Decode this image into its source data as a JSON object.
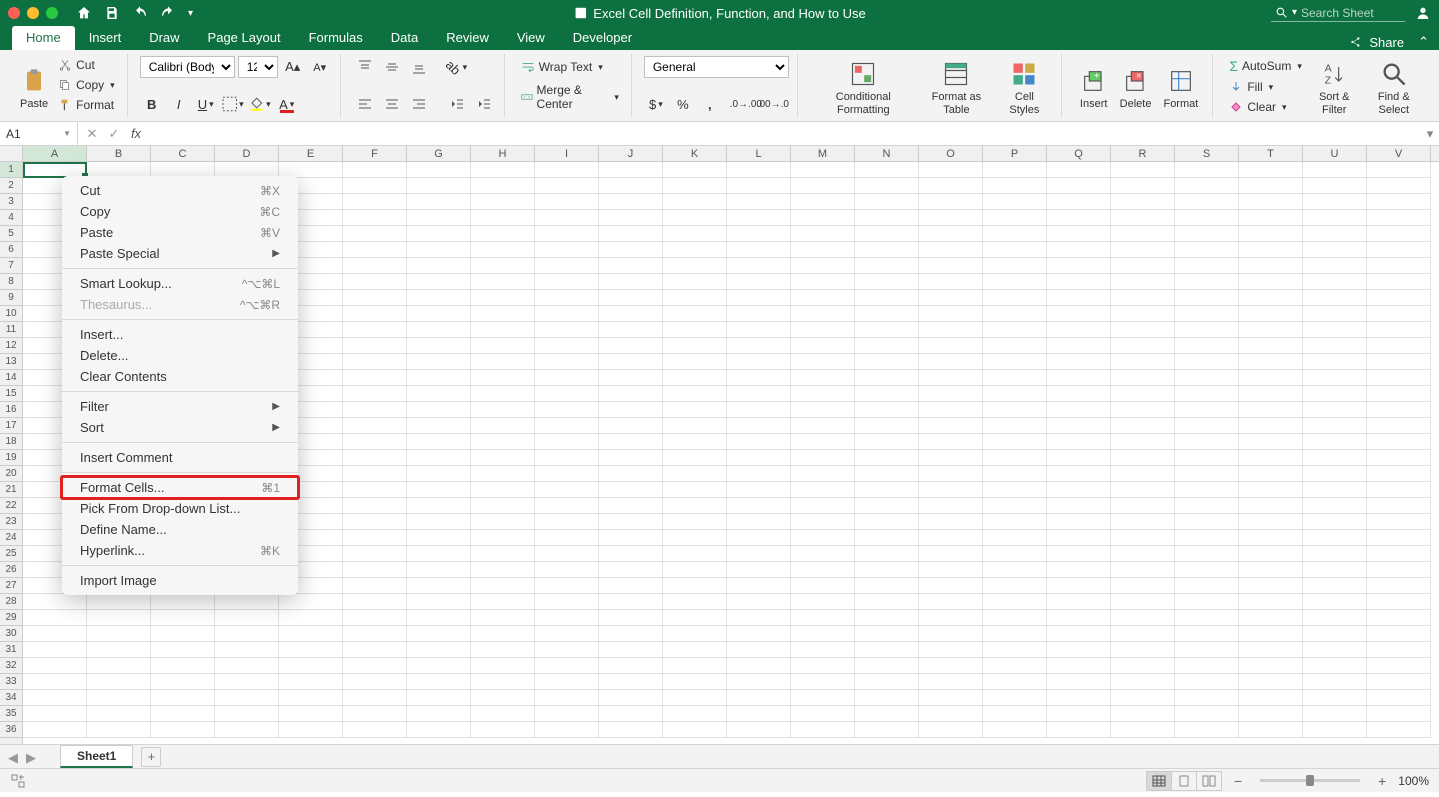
{
  "titlebar": {
    "title": "Excel Cell Definition, Function, and How to Use",
    "search_placeholder": "Search Sheet"
  },
  "tabs": {
    "items": [
      "Home",
      "Insert",
      "Draw",
      "Page Layout",
      "Formulas",
      "Data",
      "Review",
      "View",
      "Developer"
    ],
    "active": "Home",
    "share": "Share"
  },
  "ribbon": {
    "clipboard": {
      "paste": "Paste",
      "cut": "Cut",
      "copy": "Copy",
      "format": "Format"
    },
    "font": {
      "name": "Calibri (Body)",
      "size": "12"
    },
    "alignment": {
      "wrap": "Wrap Text",
      "merge": "Merge & Center"
    },
    "number": {
      "format": "General"
    },
    "styles": {
      "cf": "Conditional Formatting",
      "fat": "Format as Table",
      "cs": "Cell Styles"
    },
    "cells": {
      "insert": "Insert",
      "delete": "Delete",
      "format": "Format"
    },
    "editing": {
      "autosum": "AutoSum",
      "fill": "Fill",
      "clear": "Clear",
      "sort": "Sort & Filter",
      "find": "Find & Select"
    }
  },
  "formula": {
    "cell_ref": "A1"
  },
  "grid": {
    "cols": [
      "A",
      "B",
      "C",
      "D",
      "E",
      "F",
      "G",
      "H",
      "I",
      "J",
      "K",
      "L",
      "M",
      "N",
      "O",
      "P",
      "Q",
      "R",
      "S",
      "T",
      "U",
      "V"
    ],
    "row_count": 36
  },
  "context_menu": [
    {
      "label": "Cut",
      "shortcut": "⌘X"
    },
    {
      "label": "Copy",
      "shortcut": "⌘C"
    },
    {
      "label": "Paste",
      "shortcut": "⌘V"
    },
    {
      "label": "Paste Special",
      "sub": true
    },
    {
      "sep": true
    },
    {
      "label": "Smart Lookup...",
      "shortcut": "^⌥⌘L"
    },
    {
      "label": "Thesaurus...",
      "shortcut": "^⌥⌘R",
      "disabled": true
    },
    {
      "sep": true
    },
    {
      "label": "Insert..."
    },
    {
      "label": "Delete..."
    },
    {
      "label": "Clear Contents"
    },
    {
      "sep": true
    },
    {
      "label": "Filter",
      "sub": true
    },
    {
      "label": "Sort",
      "sub": true
    },
    {
      "sep": true
    },
    {
      "label": "Insert Comment"
    },
    {
      "sep": true
    },
    {
      "label": "Format Cells...",
      "shortcut": "⌘1",
      "highlight": true
    },
    {
      "label": "Pick From Drop-down List..."
    },
    {
      "label": "Define Name..."
    },
    {
      "label": "Hyperlink...",
      "shortcut": "⌘K"
    },
    {
      "sep": true
    },
    {
      "label": "Import Image"
    }
  ],
  "sheet": {
    "name": "Sheet1"
  },
  "status": {
    "zoom": "100%"
  }
}
